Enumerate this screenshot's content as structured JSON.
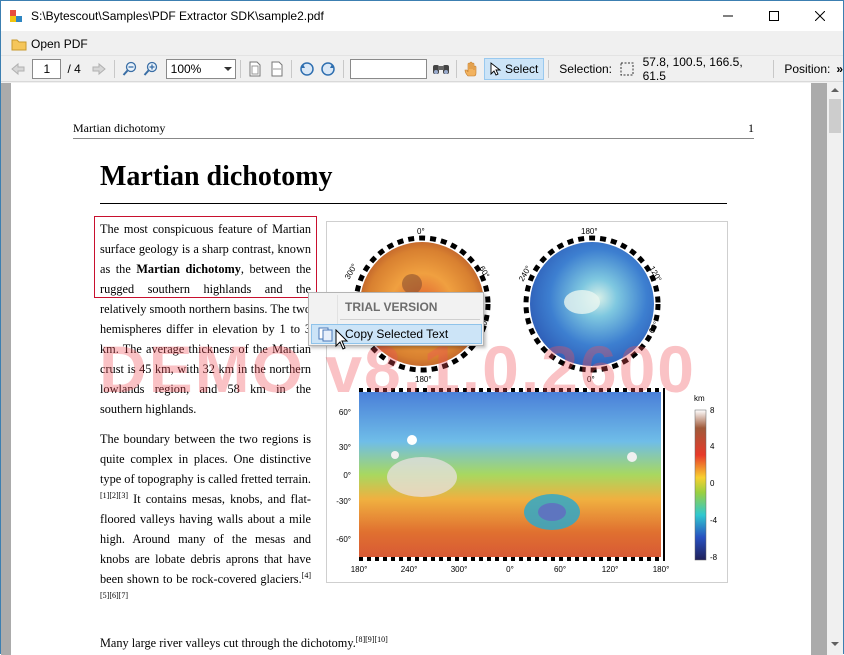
{
  "window": {
    "title": "S:\\Bytescout\\Samples\\PDF Extractor SDK\\sample2.pdf",
    "icons": {
      "minimize": "minimize-icon",
      "maximize": "maximize-icon",
      "close": "close-icon"
    }
  },
  "menubar": {
    "open_pdf_label": "Open PDF"
  },
  "toolbar": {
    "page_number": "1",
    "page_total": "/ 4",
    "zoom_value": "100%",
    "search_value": "",
    "select_label": "Select",
    "selection_label": "Selection:",
    "selection_value": "57.8, 100.5, 166.5, 61.5",
    "position_label": "Position:",
    "overflow": "»"
  },
  "document": {
    "running_header": "Martian dichotomy",
    "page_no": "1",
    "heading": "Martian dichotomy",
    "para1": {
      "t1": "The most conspicuous feature of Martian surface geology is a sharp contrast, known as the ",
      "b1": "Martian dichotomy",
      "t2": ", between the rugged southern highlands and the relatively smooth northern basins. The two hemispheres differ in elevation by 1 to 3 km. The average thickness of the Martian crust is 45 km, with 32 km in the northern lowlands region, and 58 km in the southern highlands."
    },
    "para2": {
      "t1": "The boundary between the two regions is quite complex in places. One distinctive type of topography is called fretted terrain.",
      "ref1": "[1][2][3]",
      "t2": " It contains mesas, knobs, and flat-floored valleys having walls about a mile high. Around many of the mesas and knobs are lobate debris aprons that have been shown to be rock-covered glaciers.",
      "ref2": "[4][5][6][7]"
    },
    "para3": {
      "t1": "Many large river valleys cut through the dichotomy.",
      "ref": "[8][9][10]"
    },
    "watermark": "DEMO v8.1.0.2600",
    "figure": {
      "pole_left_top": "0°",
      "pole_left_bottom": "180°",
      "pole_left_l": "300°",
      "pole_left_r": "60°",
      "pole_left_br": "120°",
      "pole_right_top": "180°",
      "pole_right_bottom": "0°",
      "pole_right_l": "240°",
      "pole_right_r": "120°",
      "pole_right_br": "60°",
      "lat_labels": [
        "60°",
        "30°",
        "0°",
        "-30°",
        "-60°"
      ],
      "lon_labels": [
        "180°",
        "240°",
        "300°",
        "0°",
        "60°",
        "120°",
        "180°"
      ],
      "scale_unit": "km",
      "scale_ticks": [
        "8",
        "4",
        "0",
        "-4",
        "-8"
      ]
    }
  },
  "context_menu": {
    "header": "TRIAL VERSION",
    "copy_label": "Copy Selected Text"
  },
  "colors": {
    "accent": "#cce4f7",
    "highlight": "#c8102e",
    "watermark": "#f0505a"
  }
}
